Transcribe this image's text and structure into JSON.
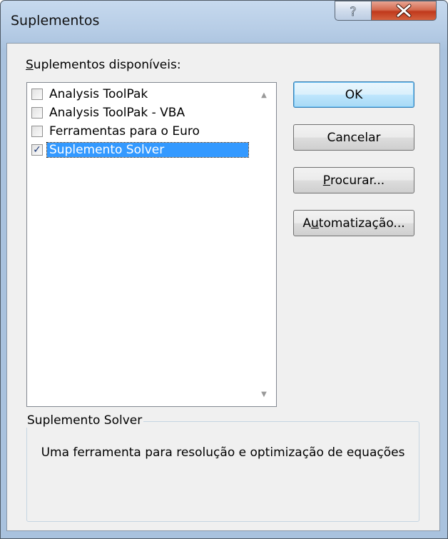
{
  "window": {
    "title": "Suplementos"
  },
  "title_buttons": {
    "help_symbol": "?",
    "close_symbol": "X",
    "help_icon": "help-icon",
    "close_icon": "close-icon"
  },
  "addins": {
    "label_first": "S",
    "label_rest": "uplementos disponíveis:",
    "items": [
      {
        "label": "Analysis ToolPak",
        "checked": false,
        "selected": false
      },
      {
        "label": "Analysis ToolPak - VBA",
        "checked": false,
        "selected": false
      },
      {
        "label": "Ferramentas para o Euro",
        "checked": false,
        "selected": false
      },
      {
        "label": "Suplemento Solver",
        "checked": true,
        "selected": true
      }
    ],
    "check_mark": "✓"
  },
  "buttons": {
    "ok": "OK",
    "cancel": "Cancelar",
    "browse_first": "P",
    "browse_rest": "rocurar...",
    "automation_pre": "A",
    "automation_mnemonic": "u",
    "automation_rest": "tomatização..."
  },
  "details": {
    "title": "Suplemento Solver",
    "description": "Uma ferramenta para resolução e optimização de equações"
  },
  "colors": {
    "selection": "#3399ff",
    "close_button": "#c0391c",
    "title_bar": "#b7cde6"
  }
}
